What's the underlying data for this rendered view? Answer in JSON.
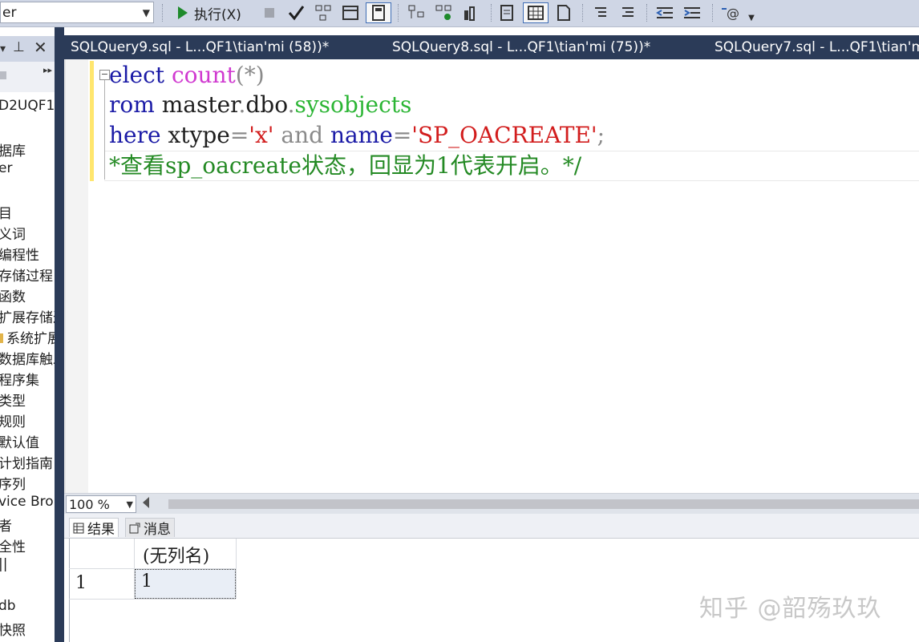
{
  "toolbar": {
    "database_combo": "er",
    "execute_label": "执行(X)"
  },
  "left_panel": {
    "items": [
      "D2UQF1",
      "据库",
      "er",
      "",
      "目",
      "义词",
      "编程性",
      "存储过程",
      "函数",
      "扩展存储过",
      "系统扩展",
      "数据库触发",
      "程序集",
      "类型",
      "规则",
      "默认值",
      "计划指南",
      "序列",
      "vice Bro",
      "者",
      "全性",
      "||",
      "",
      "db",
      "快照"
    ]
  },
  "tabs": [
    {
      "label": "SQLQuery9.sql - L...QF1\\tian'mi (58))*"
    },
    {
      "label": "SQLQuery8.sql - L...QF1\\tian'mi (75))*"
    },
    {
      "label": "SQLQuery7.sql - L...QF1\\tian'mi"
    }
  ],
  "editor": {
    "line1": {
      "kw": "elect",
      "fn": "count",
      "args": "(*)"
    },
    "line2": {
      "kw": "rom",
      "db": "master",
      "dot1": ".",
      "schema": "dbo",
      "dot2": ".",
      "obj": "sysobjects"
    },
    "line3": {
      "kw": "here",
      "col": "xtype",
      "eq1": "=",
      "val1": "'x'",
      "op": "and",
      "col2": "name",
      "eq2": "=",
      "val2": "'SP_OACREATE'",
      "semi": ";"
    },
    "line4": {
      "comment": "*查看sp_oacreate状态，回显为1代表开启。*/"
    }
  },
  "zoom": {
    "value": "100 %"
  },
  "results": {
    "tab_results": "结果",
    "tab_messages": "消息",
    "column_header": "(无列名)",
    "rows": [
      {
        "row_num": "1",
        "value": "1"
      }
    ]
  },
  "watermark": "知乎 @韶殇玖玖"
}
